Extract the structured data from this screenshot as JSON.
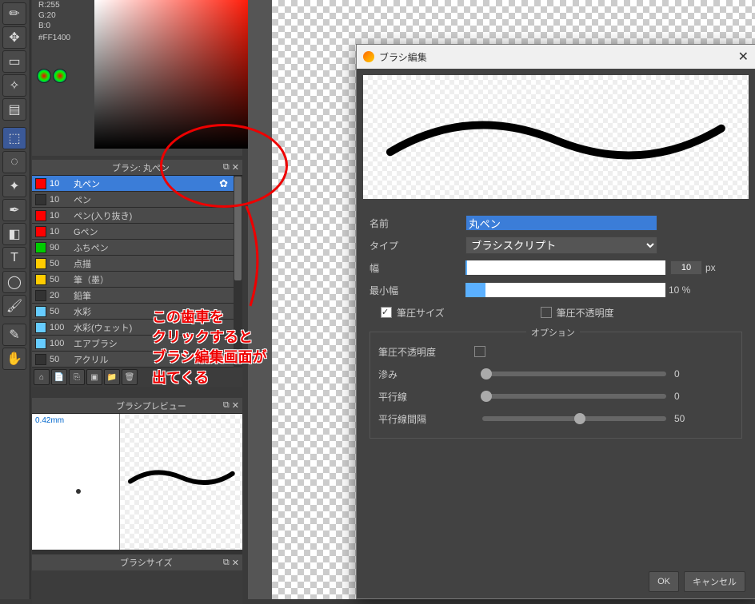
{
  "rgb": {
    "r": "R:255",
    "g": "G:20",
    "b": "B:0"
  },
  "hex": "#FF1400",
  "brush_panel_title": "ブラシ: 丸ペン",
  "brushes": [
    {
      "size": "10",
      "name": "丸ペン",
      "color": "#ff0000",
      "selected": true
    },
    {
      "size": "10",
      "name": "ペン",
      "color": "#333333"
    },
    {
      "size": "10",
      "name": "ペン(入り抜き)",
      "color": "#ff0000"
    },
    {
      "size": "10",
      "name": "Gペン",
      "color": "#ff0000"
    },
    {
      "size": "90",
      "name": "ふちペン",
      "color": "#00cc00"
    },
    {
      "size": "50",
      "name": "点描",
      "color": "#ffcc00"
    },
    {
      "size": "50",
      "name": "筆（墨）",
      "color": "#ffcc00"
    },
    {
      "size": "20",
      "name": "鉛筆",
      "color": "#333333"
    },
    {
      "size": "50",
      "name": "水彩",
      "color": "#66ccff"
    },
    {
      "size": "100",
      "name": "水彩(ウェット)",
      "color": "#66ccff"
    },
    {
      "size": "100",
      "name": "エアブラシ",
      "color": "#66ccff"
    },
    {
      "size": "50",
      "name": "アクリル",
      "color": "#333333"
    }
  ],
  "preview_title": "ブラシプレビュー",
  "preview_label": "0.42mm",
  "size_title": "ブラシサイズ",
  "dialog": {
    "title": "ブラシ編集",
    "name_label": "名前",
    "name_value": "丸ペン",
    "type_label": "タイプ",
    "type_value": "ブラシスクリプト",
    "width_label": "幅",
    "width_value": "10",
    "width_unit": "px",
    "minwidth_label": "最小幅",
    "minwidth_value": "10 %",
    "pressure_size": "筆圧サイズ",
    "pressure_opacity": "筆圧不透明度",
    "options_title": "オプション",
    "opt_pressure_opacity": "筆圧不透明度",
    "opt_bleed": "滲み",
    "opt_bleed_val": "0",
    "opt_parallel": "平行線",
    "opt_parallel_val": "0",
    "opt_interval": "平行線間隔",
    "opt_interval_val": "50",
    "ok": "OK",
    "cancel": "キャンセル"
  },
  "annotation": {
    "line1": "この歯車を",
    "line2": "クリックすると",
    "line3": "ブラシ編集画面が",
    "line4": "出てくる"
  }
}
